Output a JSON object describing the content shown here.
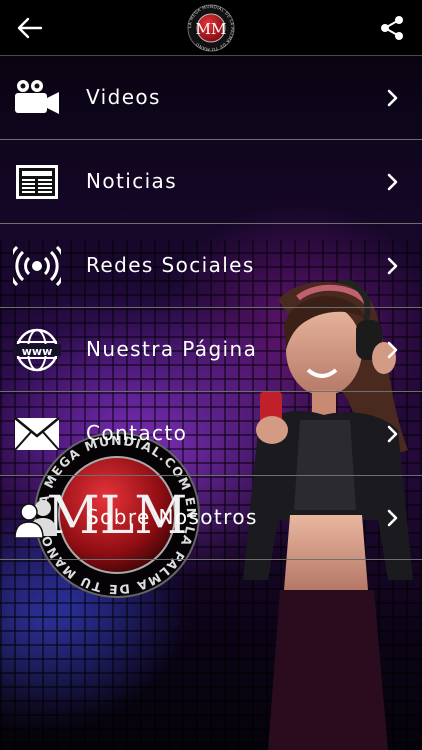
{
  "header": {
    "logo_initials": "MM",
    "logo_ring_text": "LA MEGA MUNDIAL DE LA PALMA DE TU MANO"
  },
  "menu": {
    "items": [
      {
        "label": "Videos",
        "icon": "video-camera-icon"
      },
      {
        "label": "Noticias",
        "icon": "newspaper-icon"
      },
      {
        "label": "Redes Sociales",
        "icon": "broadcast-icon"
      },
      {
        "label": "Nuestra Página",
        "icon": "globe-www-icon"
      },
      {
        "label": "Contacto",
        "icon": "envelope-icon"
      },
      {
        "label": "Sobre Nosotros",
        "icon": "people-icon"
      }
    ]
  },
  "emblem": {
    "ring_text": "LA MEGA MUNDIAL.COM EN LA PALMA DE TU MANO",
    "initials": "MLM"
  },
  "colors": {
    "header_bg": "#000000",
    "text": "#ffffff",
    "divider": "#6e6e6e",
    "logo_red": "#c0151c"
  }
}
